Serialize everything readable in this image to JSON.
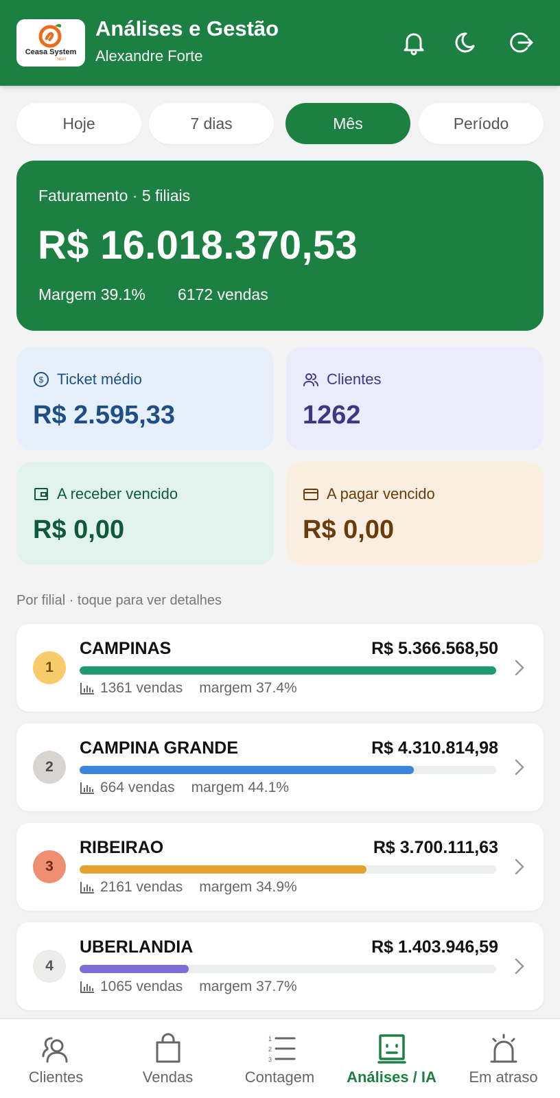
{
  "header": {
    "logo_text": "Ceasa System",
    "logo_sub": "NEXT",
    "title": "Análises e Gestão",
    "user": "Alexandre Forte",
    "icons": [
      "bell-icon",
      "moon-icon",
      "logout-icon"
    ]
  },
  "periods": [
    {
      "label": "Hoje",
      "active": false
    },
    {
      "label": "7 dias",
      "active": false
    },
    {
      "label": "Mês",
      "active": true
    },
    {
      "label": "Período",
      "active": false
    }
  ],
  "summary": {
    "label": "Faturamento · 5 filiais",
    "value": "R$ 16.018.370,53",
    "margin": "Margem 39.1%",
    "sales": "6172 vendas"
  },
  "metrics": [
    {
      "label": "Ticket médio",
      "value": "R$ 2.595,33",
      "icon": "dollar-circle-icon",
      "bg": "#e6f0fa",
      "color": "#1f4f86"
    },
    {
      "label": "Clientes",
      "value": "1262",
      "icon": "users-icon",
      "bg": "#ecebfb",
      "color": "#3f3784"
    },
    {
      "label": "A receber vencido",
      "value": "R$ 0,00",
      "icon": "wallet-icon",
      "bg": "#e1f3ec",
      "color": "#0f5a3d"
    },
    {
      "label": "A pagar vencido",
      "value": "R$ 0,00",
      "icon": "card-icon",
      "bg": "#faeee0",
      "color": "#6b3c0b"
    }
  ],
  "branches_label": "Por filial · toque para ver detalhes",
  "branches": [
    {
      "rank": "1",
      "name": "CAMPINAS",
      "value": "R$ 5.366.568,50",
      "sales": "1361 vendas",
      "margin": "margem 37.4%",
      "share": 1.0,
      "bar_color": "#1f9a6c",
      "rank_bg": "#f8cb6a",
      "rank_color": "#7a4f00"
    },
    {
      "rank": "2",
      "name": "CAMPINA GRANDE",
      "value": "R$ 4.310.814,98",
      "sales": "664 vendas",
      "margin": "margem 44.1%",
      "share": 0.803,
      "bar_color": "#3b86d8",
      "rank_bg": "#d8d5d0",
      "rank_color": "#4b4b4b"
    },
    {
      "rank": "3",
      "name": "RIBEIRAO",
      "value": "R$ 3.700.111,63",
      "sales": "2161 vendas",
      "margin": "margem 34.9%",
      "share": 0.689,
      "bar_color": "#e5a12e",
      "rank_bg": "#ef8f72",
      "rank_color": "#6a2a15"
    },
    {
      "rank": "4",
      "name": "UBERLANDIA",
      "value": "R$ 1.403.946,59",
      "sales": "1065 vendas",
      "margin": "margem 37.7%",
      "share": 0.262,
      "bar_color": "#7b6fd6",
      "rank_bg": "#ececea",
      "rank_color": "#555555"
    }
  ],
  "bottom_nav": [
    {
      "label": "Clientes",
      "icon": "users-icon",
      "active": false
    },
    {
      "label": "Vendas",
      "icon": "shopping-bag-icon",
      "active": false
    },
    {
      "label": "Contagem",
      "icon": "numbered-list-icon",
      "active": false
    },
    {
      "label": "Análises / IA",
      "icon": "robot-icon",
      "active": true
    },
    {
      "label": "Em atraso",
      "icon": "alarm-light-icon",
      "active": false
    }
  ],
  "colors": {
    "brand": "#1b8042",
    "background": "#f2f3f2"
  }
}
